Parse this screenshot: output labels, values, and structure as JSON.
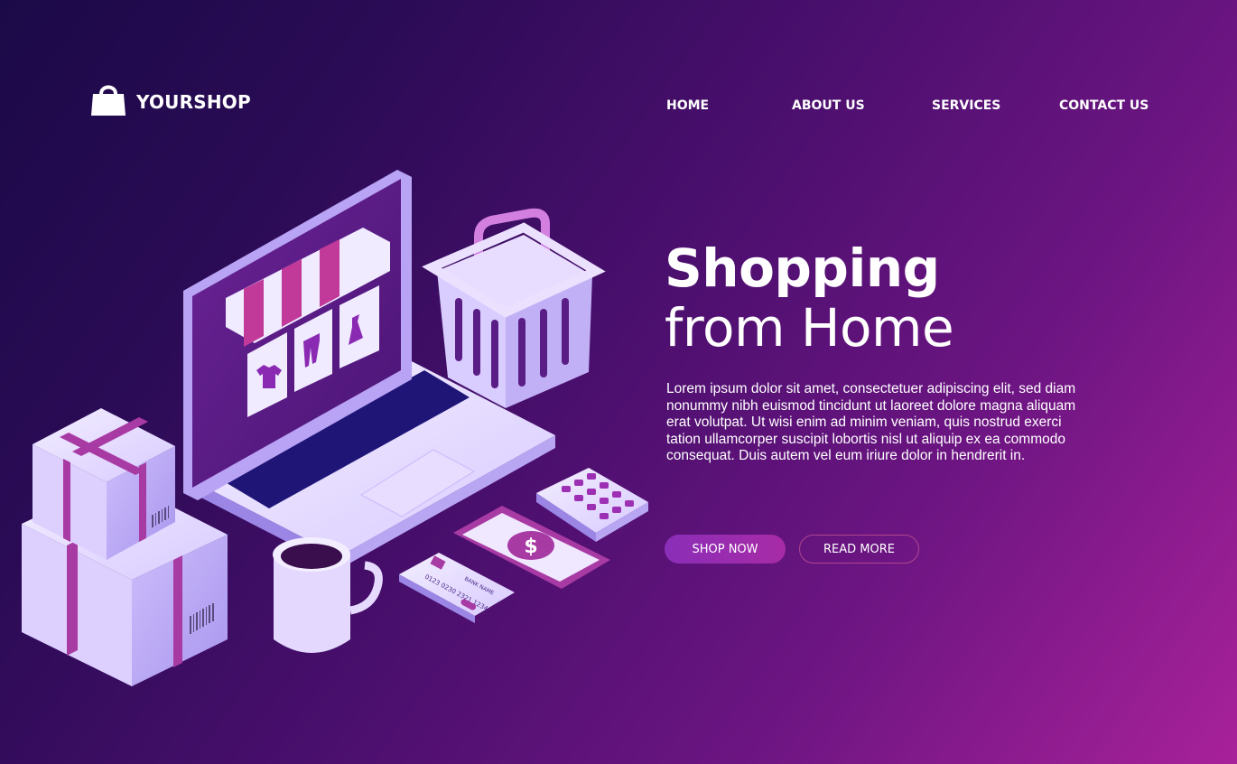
{
  "brand": {
    "name": "YOURSHOP",
    "icon": "shopping-bag-icon"
  },
  "nav": {
    "items": [
      "HOME",
      "ABOUT US",
      "SERVICES",
      "CONTACT US"
    ]
  },
  "hero": {
    "title_line1": "Shopping",
    "title_line2": "from Home",
    "body": "Lorem ipsum dolor sit amet, consectetuer adipiscing elit, sed diam nonummy nibh euismod tincidunt ut laoreet dolore magna aliquam erat volutpat. Ut wisi enim ad minim veniam, quis nostrud exerci tation ullamcorper suscipit lobortis nisl ut aliquip ex ea commodo consequat. Duis autem vel eum iriure dolor in hendrerit in."
  },
  "buttons": {
    "shop_now": "SHOP NOW",
    "read_more": "READ MORE"
  },
  "illustration": {
    "card_number": "0123 0230 2321 1234",
    "card_name": "BANK NAME",
    "currency_symbol": "$"
  },
  "colors": {
    "bg_dark": "#1b0a48",
    "bg_mid": "#4a0f6d",
    "bg_light": "#a8219a",
    "accent": "#a82ba6",
    "lavender": "#e2d6ff"
  }
}
